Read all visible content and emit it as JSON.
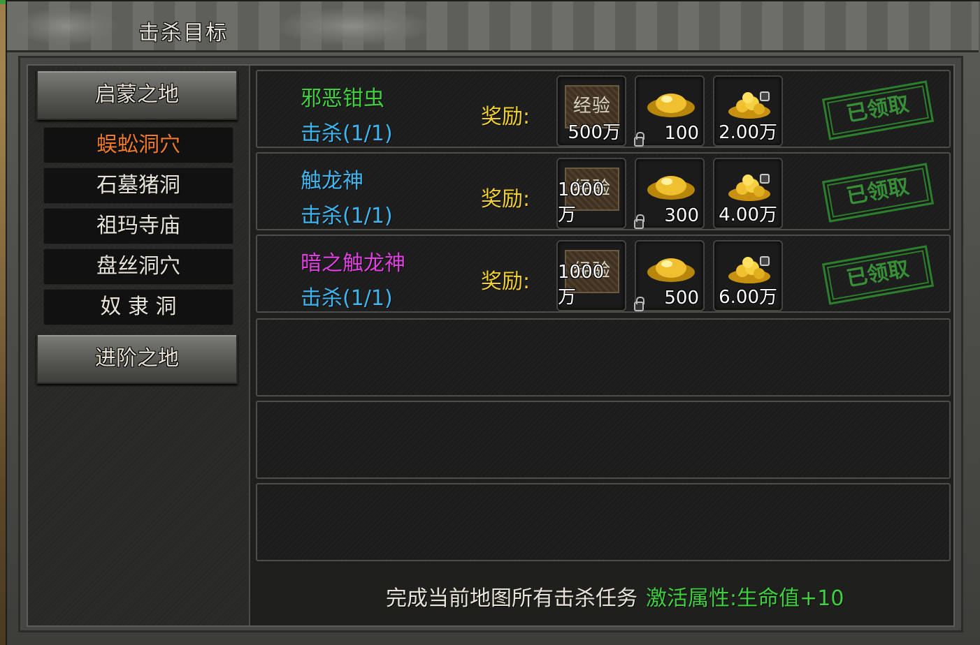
{
  "window": {
    "title": "击杀目标"
  },
  "categories": [
    {
      "label": "启蒙之地"
    },
    {
      "label": "进阶之地"
    }
  ],
  "maps": [
    {
      "label": "蜈蚣洞穴",
      "active": true
    },
    {
      "label": "石墓猪洞",
      "active": false
    },
    {
      "label": "祖玛寺庙",
      "active": false
    },
    {
      "label": "盘丝洞穴",
      "active": false
    },
    {
      "label": "奴 隶 洞",
      "active": false
    }
  ],
  "reward_label": "奖励:",
  "targets": [
    {
      "name": "邪恶钳虫",
      "name_color": "#3fcf3f",
      "kill": "击杀(1/1)",
      "rewards": {
        "exp_label": "经验",
        "exp": "500万",
        "ingot": "100",
        "coins": "2.00万"
      },
      "status": "已领取"
    },
    {
      "name": "触龙神",
      "name_color": "#3fb6f0",
      "kill": "击杀(1/1)",
      "rewards": {
        "exp_label": "经验",
        "exp": "1000万",
        "ingot": "300",
        "coins": "4.00万"
      },
      "status": "已领取"
    },
    {
      "name": "暗之触龙神",
      "name_color": "#e040e0",
      "kill": "击杀(1/1)",
      "rewards": {
        "exp_label": "经验",
        "exp": "1000万",
        "ingot": "500",
        "coins": "6.00万"
      },
      "status": "已领取"
    }
  ],
  "footer": {
    "text": "完成当前地图所有击杀任务",
    "attr_label": "激活属性:",
    "attr_value": "生命值+10"
  }
}
